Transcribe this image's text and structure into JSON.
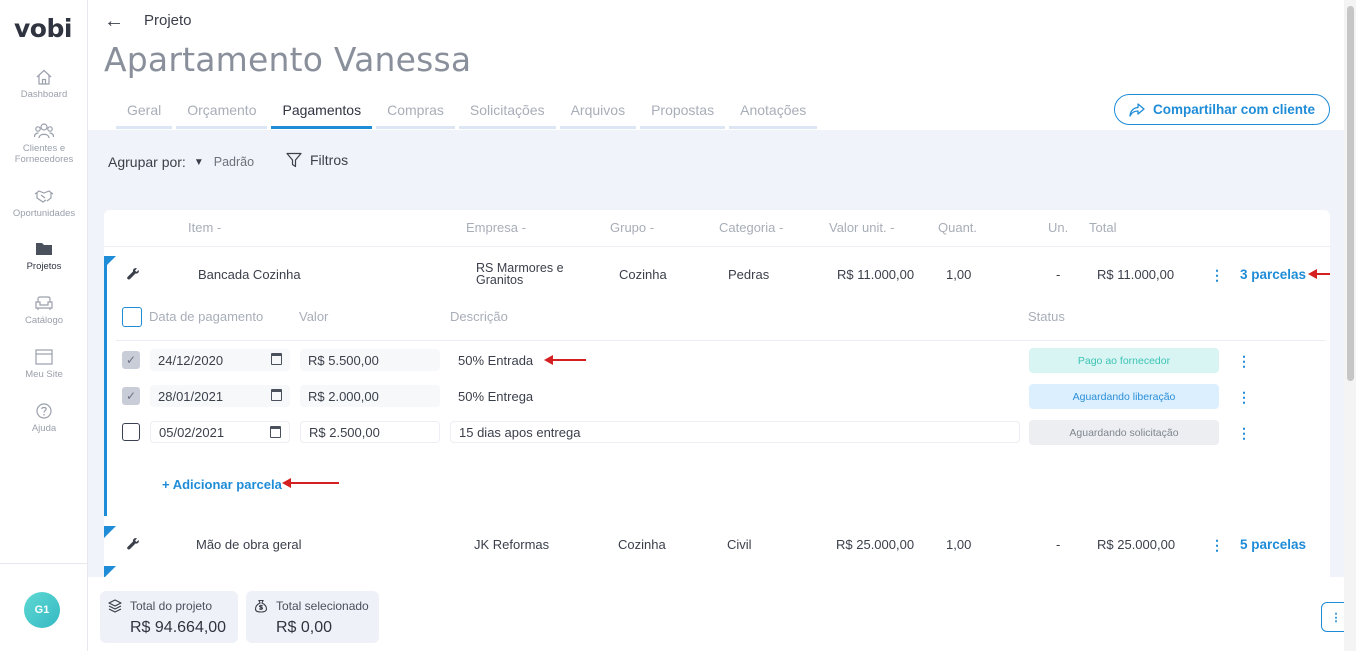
{
  "app": {
    "logo": "vobi"
  },
  "sidebar": {
    "items": [
      {
        "label": "Dashboard",
        "icon": "home-icon"
      },
      {
        "label": "Clientes e Fornecedores",
        "icon": "users-icon"
      },
      {
        "label": "Oportunidades",
        "icon": "handshake-icon"
      },
      {
        "label": "Projetos",
        "icon": "folder-icon",
        "active": true
      },
      {
        "label": "Catálogo",
        "icon": "sofa-icon"
      },
      {
        "label": "Meu Site",
        "icon": "browser-icon"
      },
      {
        "label": "Ajuda",
        "icon": "help-icon"
      }
    ],
    "avatar": "G1"
  },
  "header": {
    "breadcrumb": "Projeto",
    "title": "Apartamento Vanessa",
    "tabs": [
      {
        "label": "Geral"
      },
      {
        "label": "Orçamento"
      },
      {
        "label": "Pagamentos",
        "active": true
      },
      {
        "label": "Compras"
      },
      {
        "label": "Solicitações"
      },
      {
        "label": "Arquivos"
      },
      {
        "label": "Propostas"
      },
      {
        "label": "Anotações"
      }
    ],
    "share_label": "Compartilhar com cliente"
  },
  "toolbar": {
    "group_label": "Agrupar por:",
    "group_value": "Padrão",
    "filters_label": "Filtros"
  },
  "table": {
    "columns": {
      "item": "Item -",
      "empresa": "Empresa -",
      "grupo": "Grupo -",
      "categoria": "Categoria -",
      "valor_unit": "Valor unit. -",
      "quant": "Quant.",
      "un": "Un.",
      "total": "Total"
    },
    "rows": [
      {
        "item": "Bancada Cozinha",
        "empresa_line1": "RS Marmores e",
        "empresa_line2": "Granitos",
        "grupo": "Cozinha",
        "categoria": "Pedras",
        "valor_unit": "R$ 11.000,00",
        "quant": "1,00",
        "un": "-",
        "total": "R$ 11.000,00",
        "parcelas": "3 parcelas"
      },
      {
        "item": "Mão de obra geral",
        "empresa": "JK Reformas",
        "grupo": "Cozinha",
        "categoria": "Civil",
        "valor_unit": "R$ 25.000,00",
        "quant": "1,00",
        "un": "-",
        "total": "R$ 25.000,00",
        "parcelas": "5 parcelas"
      }
    ]
  },
  "installments": {
    "columns": {
      "date": "Data de pagamento",
      "value": "Valor",
      "description": "Descrição",
      "status": "Status"
    },
    "rows": [
      {
        "date": "24/12/2020",
        "value": "R$ 5.500,00",
        "description": "50% Entrada",
        "status": "Pago ao fornecedor",
        "checked": true
      },
      {
        "date": "28/01/2021",
        "value": "R$ 2.000,00",
        "description": "50% Entrega",
        "status": "Aguardando liberação",
        "checked": true
      },
      {
        "date": "05/02/2021",
        "value": "R$ 2.500,00",
        "description": "15 dias apos entrega",
        "status": "Aguardando solicitação",
        "checked": false
      }
    ],
    "add_label": "+ Adicionar parcela",
    "status_colors": {
      "paid": "#3cc3b4",
      "waiting_release": "#2a8fd8",
      "waiting_request": "#80868f"
    }
  },
  "footer": {
    "total_project_label": "Total do projeto",
    "total_project_value": "R$ 94.664,00",
    "total_selected_label": "Total selecionado",
    "total_selected_value": "R$ 0,00"
  },
  "colors": {
    "accent": "#1f8cd8",
    "annotation_arrow": "#d42020"
  }
}
